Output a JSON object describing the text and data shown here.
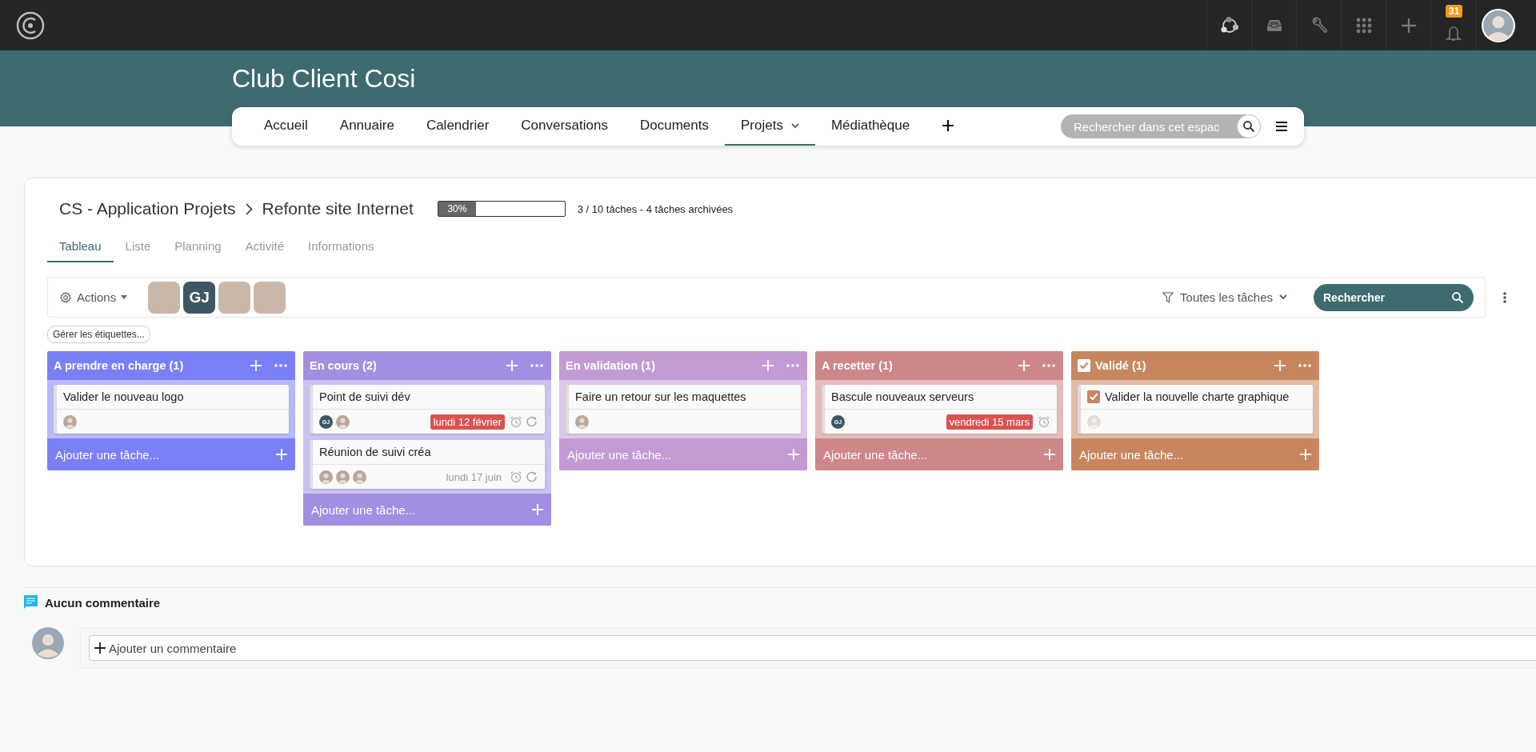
{
  "topbar": {
    "notification_count": "31"
  },
  "space": {
    "title": "Club Client Cosi",
    "nav": [
      {
        "label": "Accueil",
        "selected": false,
        "kind": "link"
      },
      {
        "label": "Annuaire",
        "selected": false,
        "kind": "link"
      },
      {
        "label": "Calendrier",
        "selected": false,
        "kind": "link"
      },
      {
        "label": "Conversations",
        "selected": false,
        "kind": "link"
      },
      {
        "label": "Documents",
        "selected": false,
        "kind": "link"
      },
      {
        "label": "Projets",
        "selected": true,
        "kind": "menu"
      },
      {
        "label": "Médiathèque",
        "selected": false,
        "kind": "link"
      }
    ],
    "search_placeholder": "Rechercher dans cet espac"
  },
  "project": {
    "breadcrumb": [
      "CS - Application Projets",
      "Refonte site Internet"
    ],
    "progress": {
      "level": 0.3,
      "label": "30%"
    },
    "summary": "3 / 10 tâches - 4 tâches archivées",
    "tabs": [
      {
        "label": "Tableau",
        "selected": true
      },
      {
        "label": "Liste",
        "selected": false
      },
      {
        "label": "Planning",
        "selected": false
      },
      {
        "label": "Activité",
        "selected": false
      },
      {
        "label": "Informations",
        "selected": false
      }
    ]
  },
  "toolbar": {
    "actions_label": "Actions",
    "members": [
      {
        "kind": "photo"
      },
      {
        "kind": "initials",
        "initials": "GJ"
      },
      {
        "kind": "photo"
      },
      {
        "kind": "photo"
      }
    ],
    "filter_label": "Toutes les tâches",
    "search_placeholder": "Rechercher"
  },
  "manage_tags_label": "Gérer les étiquettes...",
  "columns": [
    {
      "title": "A prendre en charge (1)",
      "color": "#7b7ff6",
      "kind": "open",
      "add_label": "Ajouter une tâche...",
      "cards": [
        {
          "title": "Valider le nouveau logo",
          "done": false,
          "assignees": [
            {
              "kind": "photo"
            }
          ],
          "reminder": false,
          "recurring": false
        }
      ]
    },
    {
      "title": "En cours (2)",
      "color": "#a28ee2",
      "kind": "open",
      "add_label": "Ajouter une tâche...",
      "cards": [
        {
          "title": "Point de suivi dév",
          "done": false,
          "assignees": [
            {
              "kind": "initials",
              "initials": "GJ"
            },
            {
              "kind": "photo"
            }
          ],
          "due": {
            "text": "lundi 12 février",
            "overdue": true
          },
          "reminder": true,
          "recurring": true
        },
        {
          "title": "Réunion de suivi créa",
          "done": false,
          "assignees": [
            {
              "kind": "photo"
            },
            {
              "kind": "photo"
            },
            {
              "kind": "photo"
            }
          ],
          "due": {
            "text": "lundi 17 juin",
            "overdue": false
          },
          "reminder": true,
          "recurring": true
        }
      ]
    },
    {
      "title": "En validation (1)",
      "color": "#c39bd4",
      "kind": "open",
      "add_label": "Ajouter une tâche...",
      "cards": [
        {
          "title": "Faire un retour sur les maquettes",
          "done": false,
          "assignees": [
            {
              "kind": "photo"
            }
          ],
          "reminder": false,
          "recurring": false
        }
      ]
    },
    {
      "title": "A recetter (1)",
      "color": "#cd8689",
      "kind": "open",
      "add_label": "Ajouter une tâche...",
      "cards": [
        {
          "title": "Bascule nouveaux serveurs",
          "done": false,
          "assignees": [
            {
              "kind": "initials",
              "initials": "GJ"
            }
          ],
          "due": {
            "text": "vendredi 15 mars",
            "overdue": true
          },
          "reminder": true,
          "recurring": false
        }
      ]
    },
    {
      "title": "Validé (1)",
      "color": "#c8865f",
      "kind": "done",
      "add_label": "Ajouter une tâche...",
      "cards": [
        {
          "title": "Valider la nouvelle charte graphique",
          "done": true,
          "assignees": [
            {
              "kind": "photo"
            }
          ],
          "reminder": false,
          "recurring": false
        }
      ]
    }
  ],
  "comments": {
    "heading": "Aucun commentaire",
    "add_label": "Ajouter un commentaire"
  }
}
